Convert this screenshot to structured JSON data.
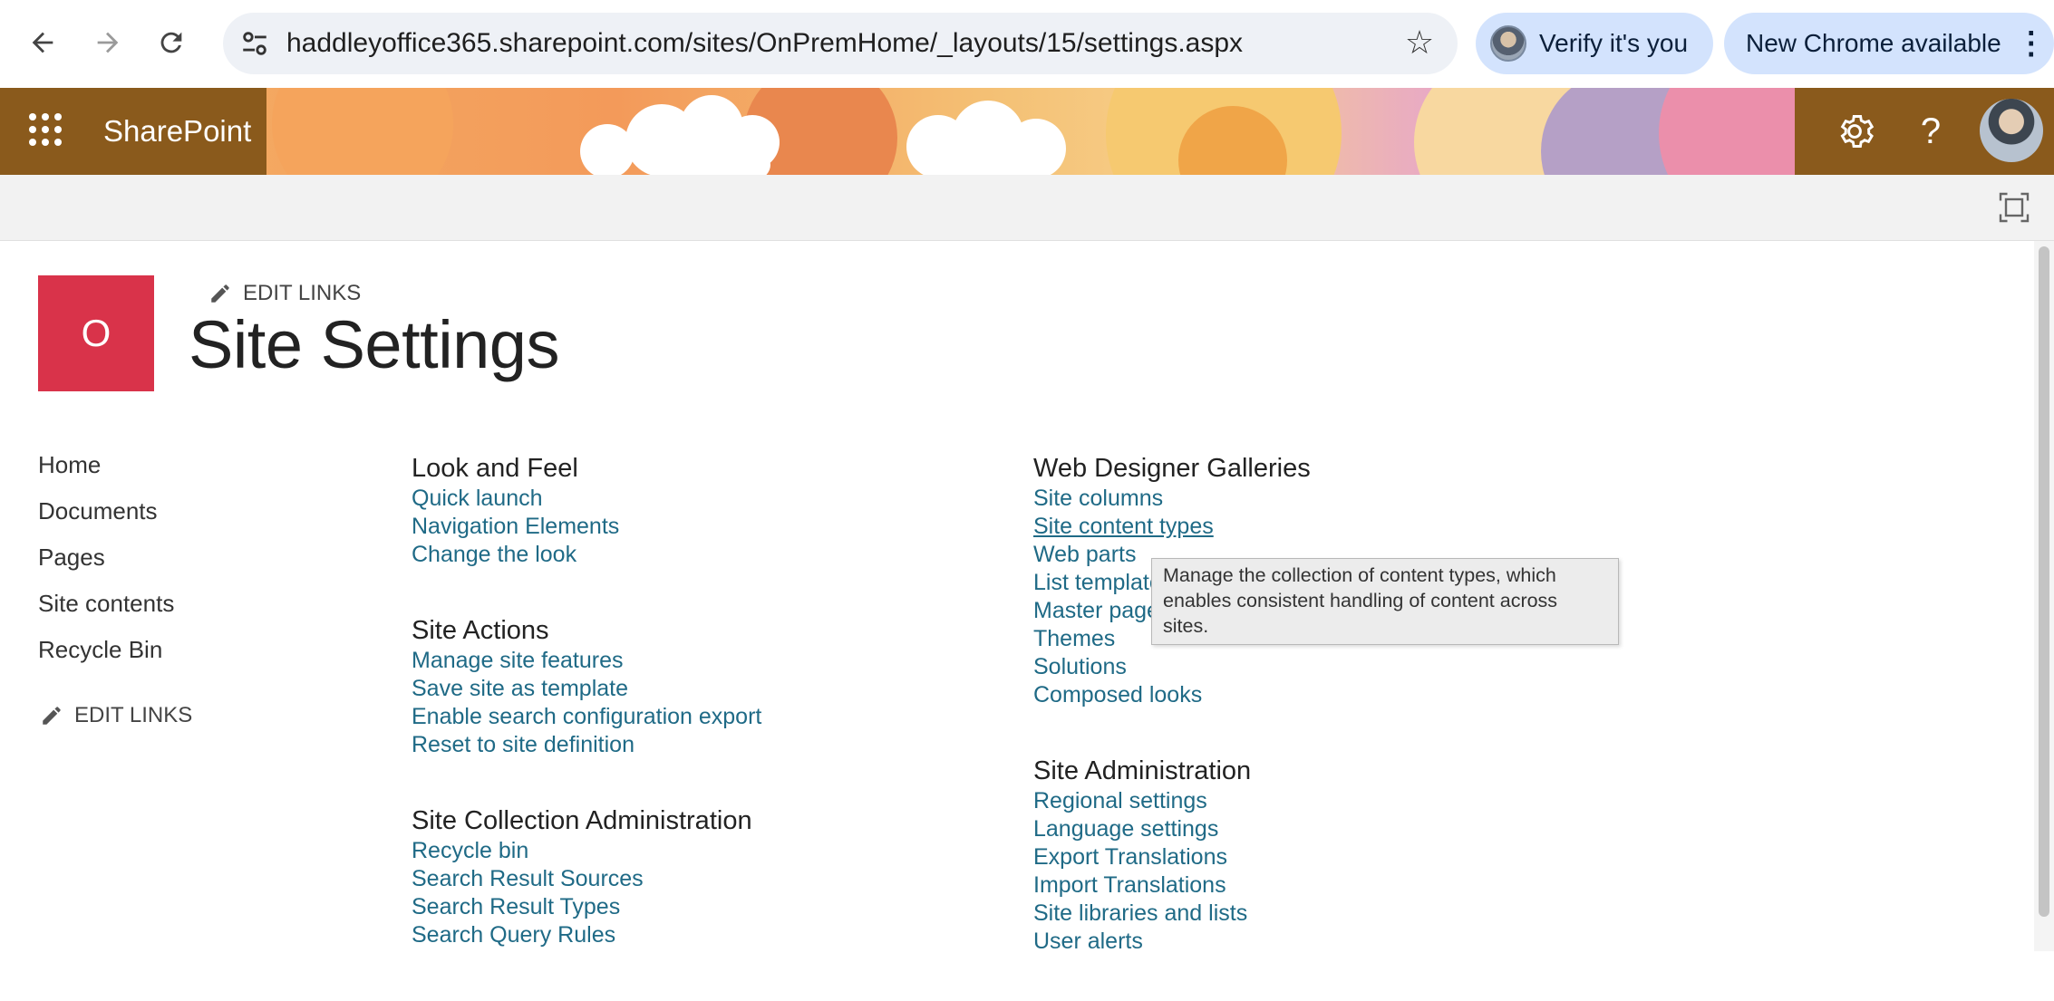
{
  "browser": {
    "url": "haddleyoffice365.sharepoint.com/sites/OnPremHome/_layouts/15/settings.aspx",
    "verify_label": "Verify it's you",
    "update_label": "New Chrome available"
  },
  "suite": {
    "brand": "SharePoint"
  },
  "header": {
    "logo_letter": "O",
    "edit_links": "EDIT LINKS",
    "title": "Site Settings"
  },
  "quicklaunch": {
    "items": [
      {
        "label": "Home"
      },
      {
        "label": "Documents"
      },
      {
        "label": "Pages"
      },
      {
        "label": "Site contents"
      },
      {
        "label": "Recycle Bin"
      }
    ],
    "edit_links": "EDIT LINKS"
  },
  "groups": {
    "look_and_feel": {
      "title": "Look and Feel",
      "links": [
        "Quick launch",
        "Navigation Elements",
        "Change the look"
      ]
    },
    "site_actions": {
      "title": "Site Actions",
      "links": [
        "Manage site features",
        "Save site as template",
        "Enable search configuration export",
        "Reset to site definition"
      ]
    },
    "site_collection_admin": {
      "title": "Site Collection Administration",
      "links": [
        "Recycle bin",
        "Search Result Sources",
        "Search Result Types",
        "Search Query Rules"
      ]
    },
    "web_designer": {
      "title": "Web Designer Galleries",
      "links": [
        "Site columns",
        "Site content types",
        "Web parts",
        "List templates",
        "Master pages",
        "Themes",
        "Solutions",
        "Composed looks"
      ]
    },
    "site_admin": {
      "title": "Site Administration",
      "links": [
        "Regional settings",
        "Language settings",
        "Export Translations",
        "Import Translations",
        "Site libraries and lists",
        "User alerts"
      ]
    }
  },
  "tooltip": {
    "text": "Manage the collection of content types, which enables consistent handling of content across sites."
  },
  "colors": {
    "link": "#1f6a86",
    "logo": "#d9334a",
    "suite_dark": "#8a5a1c"
  }
}
